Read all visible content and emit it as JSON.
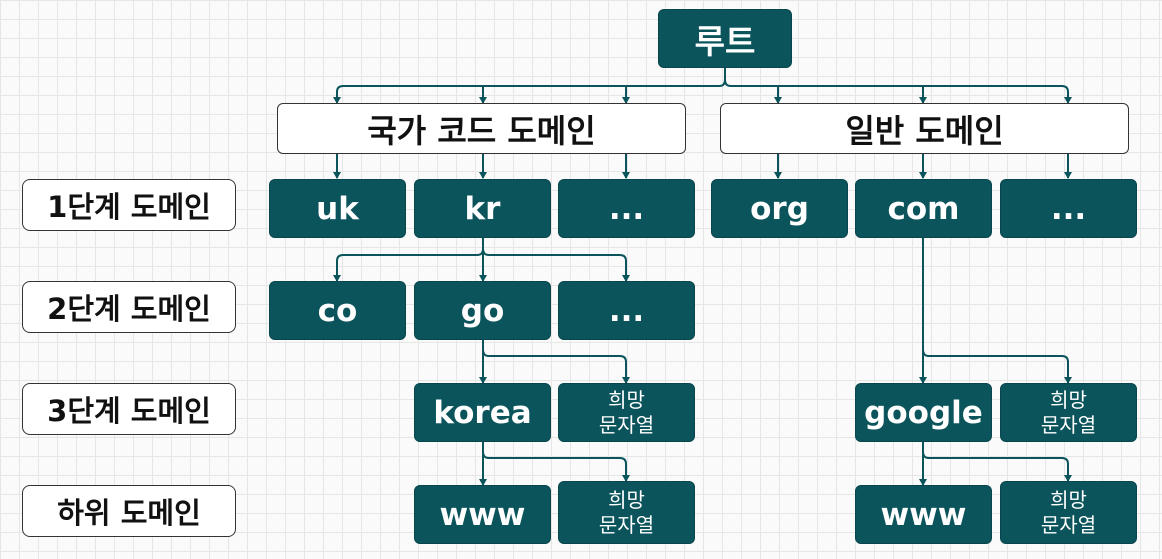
{
  "colors": {
    "node_fill": "#0b545c",
    "edge": "#0b545c",
    "group_fill": "#ffffff"
  },
  "root": "루트",
  "groups": {
    "country": "국가 코드 도메인",
    "general": "일반 도메인"
  },
  "levels": {
    "level1": "1단계 도메인",
    "level2": "2단계 도메인",
    "level3": "3단계 도메인",
    "sub": "하위 도메인"
  },
  "nodes": {
    "uk": "uk",
    "kr": "kr",
    "ellipsis_country": "...",
    "org": "org",
    "com": "com",
    "ellipsis_general": "...",
    "co": "co",
    "go": "go",
    "ellipsis_kr": "...",
    "korea": "korea",
    "wish_korea": "희망\n문자열",
    "www_korea": "www",
    "wish_www_korea": "희망\n문자열",
    "google": "google",
    "wish_google": "희망\n문자열",
    "www_google": "www",
    "wish_www_google": "희망\n문자열"
  }
}
